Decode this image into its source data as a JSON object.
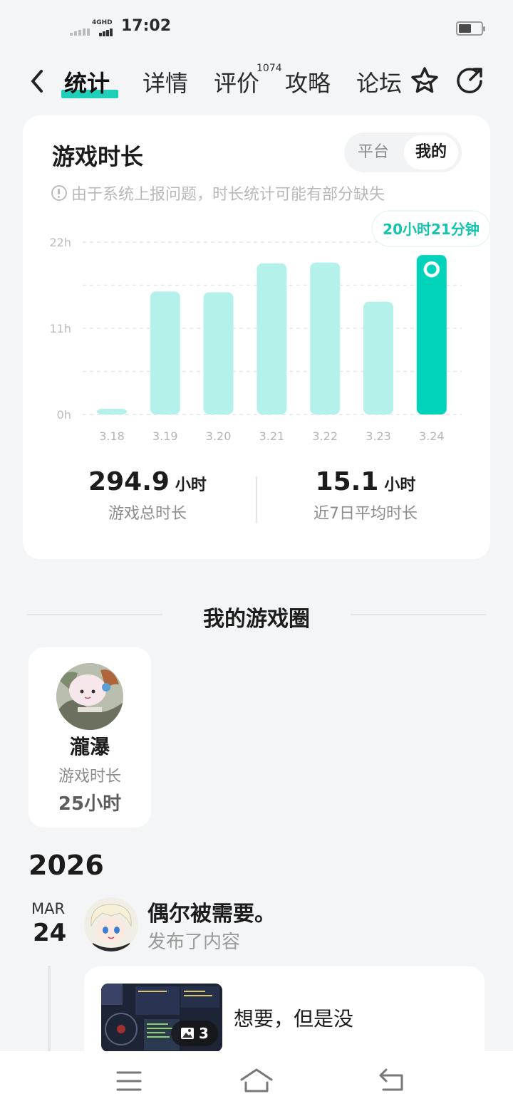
{
  "status_bar": {
    "network": "4GHD",
    "time": "17:02",
    "battery_level": 0.55
  },
  "nav": {
    "tabs": [
      {
        "label": "统计",
        "active": true
      },
      {
        "label": "详情",
        "active": false
      },
      {
        "label": "评价",
        "active": false,
        "badge": "1074"
      },
      {
        "label": "攻略",
        "active": false
      },
      {
        "label": "论坛",
        "active": false
      }
    ],
    "icons": [
      "back-icon",
      "star-icon",
      "share-icon"
    ]
  },
  "playtime_card": {
    "title": "游戏时长",
    "segment": {
      "options": [
        "平台",
        "我的"
      ],
      "selected": "我的"
    },
    "notice": "由于系统上报问题，时长统计可能有部分缺失",
    "stats": [
      {
        "value": "294.9",
        "unit": "小时",
        "label": "游戏总时长"
      },
      {
        "value": "15.1",
        "unit": "小时",
        "label": "近7日平均时长"
      }
    ]
  },
  "chart_data": {
    "type": "bar",
    "categories": [
      "3.18",
      "3.19",
      "3.20",
      "3.21",
      "3.22",
      "3.23",
      "3.24"
    ],
    "values": [
      0.5,
      15.7,
      15.6,
      19.3,
      19.4,
      14.4,
      20.35
    ],
    "y_ticks": [
      "0h",
      "11h",
      "22h"
    ],
    "ylim": [
      0,
      22
    ],
    "highlight_index": 6,
    "tooltip": "20小时21分钟",
    "grid": true,
    "colors": {
      "bar": "#b3f1ea",
      "highlight": "#00d3ba",
      "tooltip_text": "#14c4ae"
    }
  },
  "game_circle": {
    "title": "我的游戏圈",
    "friends": [
      {
        "name": "瀧瀑",
        "playtime_label": "游戏时长",
        "playtime": "25小时"
      }
    ]
  },
  "feed": {
    "year": "2026",
    "entries": [
      {
        "month": "MAR",
        "day": "24",
        "user": "偶尔被需要。",
        "action": "发布了内容",
        "image_count": "3",
        "text": "想要，但是没"
      }
    ]
  },
  "bottom_nav": [
    "menu-icon",
    "home-icon",
    "back-nav-icon"
  ],
  "colors": {
    "accent": "#1fcfb8",
    "background": "#f4f5f7"
  }
}
